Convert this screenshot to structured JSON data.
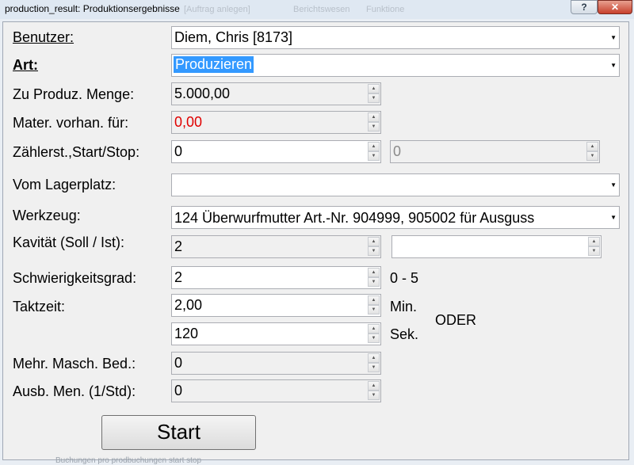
{
  "window": {
    "title": "production_result: Produktionsergebnisse",
    "background_menu": [
      "[Auftrag anlegen]",
      "Berichtswesen",
      "Funktione"
    ],
    "help_label": "?",
    "close_label": "✕"
  },
  "form": {
    "benutzer_label": "Benutzer:",
    "benutzer_value": "Diem, Chris [8173]",
    "art_label": "Art:",
    "art_value": "Produzieren",
    "menge_label": "Zu Produz. Menge:",
    "menge_value": "5.000,00",
    "mater_label": "Mater. vorhan. für:",
    "mater_value": "0,00",
    "zaehler_label": "Zählerst.,Start/Stop:",
    "zaehler_start": "0",
    "zaehler_stop": "0",
    "lager_label": "Vom Lagerplatz:",
    "lager_value": "",
    "werkzeug_label": "Werkzeug:",
    "werkzeug_value": "124  Überwurfmutter  Art.-Nr. 904999, 905002  für Ausguss",
    "kavitaet_label": "Kavität (Soll / Ist):",
    "kavitaet_soll": "2",
    "kavitaet_ist": "",
    "schwierig_label": "Schwierigkeitsgrad:",
    "schwierig_value": "2",
    "schwierig_range": "0 - 5",
    "takt_label": "Taktzeit:",
    "takt_min_value": "2,00",
    "takt_min_unit": "Min.",
    "takt_sek_value": "120",
    "takt_sek_unit": "Sek.",
    "oder_label": "ODER",
    "mehr_label": "Mehr. Masch. Bed.:",
    "mehr_value": "0",
    "ausb_label": "Ausb. Men. (1/Std):",
    "ausb_value": "0",
    "start_label": "Start"
  },
  "background_footer": "Buchungen pro prodbuchungen start stop"
}
